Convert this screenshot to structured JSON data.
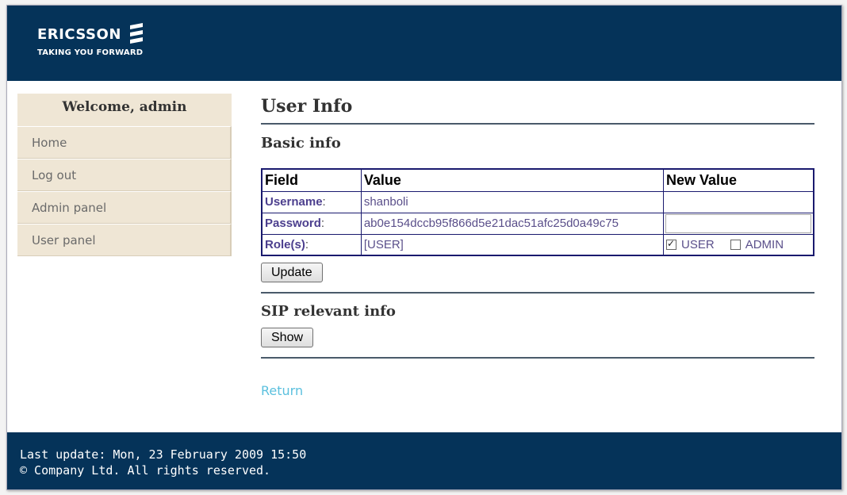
{
  "header": {
    "brand": "ERICSSON",
    "tagline": "TAKING YOU FORWARD",
    "icon": "ericsson-logo-mark",
    "color": "#053359"
  },
  "sidebar": {
    "welcome": "Welcome, admin",
    "items": [
      {
        "label": "Home"
      },
      {
        "label": "Log out"
      },
      {
        "label": "Admin panel"
      },
      {
        "label": "User panel"
      }
    ]
  },
  "main": {
    "title": "User Info",
    "basic_heading": "Basic info",
    "table": {
      "headers": [
        "Field",
        "Value",
        "New Value"
      ],
      "rows": [
        {
          "field": "Username",
          "value": "shanboli"
        },
        {
          "field": "Password",
          "value": "ab0e154dccb95f866d5e21dac51afc25d0a49c75"
        },
        {
          "field": "Role(s)",
          "value": "[USER]"
        }
      ],
      "roles": [
        {
          "label": "USER",
          "checked": true
        },
        {
          "label": "ADMIN",
          "checked": false
        }
      ]
    },
    "update_label": "Update",
    "sip_heading": "SIP relevant info",
    "show_label": "Show",
    "return_label": "Return"
  },
  "footer": {
    "last_update": "Last update: Mon, 23 February 2009 15:50",
    "copyright": "© Company Ltd. All rights reserved."
  }
}
